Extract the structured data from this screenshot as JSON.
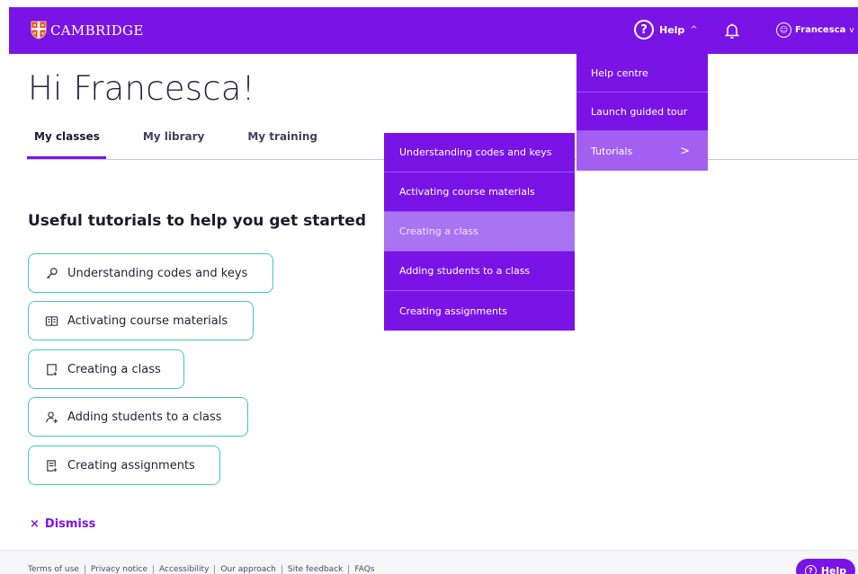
{
  "header": {
    "brand": "CAMBRIDGE",
    "help_label": "Help",
    "help_chevron": "^",
    "user_name": "Francesca",
    "user_chevron": "v"
  },
  "greeting": "Hi Francesca!",
  "tabs": [
    {
      "label": "My classes",
      "active": true
    },
    {
      "label": "My library",
      "active": false
    },
    {
      "label": "My training",
      "active": false
    }
  ],
  "tutorials": {
    "title": "Useful tutorials to help you get started",
    "items": [
      {
        "label": "Understanding codes and keys",
        "icon": "key-icon"
      },
      {
        "label": "Activating course materials",
        "icon": "book-icon"
      },
      {
        "label": "Creating a class",
        "icon": "add-document-icon"
      },
      {
        "label": "Adding students to a class",
        "icon": "add-user-icon"
      },
      {
        "label": "Creating assignments",
        "icon": "assignment-icon"
      }
    ],
    "dismiss": "Dismiss"
  },
  "help_menu": {
    "items": [
      "Help centre",
      "Launch guided tour",
      "Tutorials"
    ],
    "submenu_arrow": ">",
    "submenu": [
      "Understanding codes and keys",
      "Activating course materials",
      "Creating a class",
      "Adding students to a class",
      "Creating assignments"
    ],
    "hovered_index": 2
  },
  "footer": {
    "links": [
      "Terms of use",
      "Privacy notice",
      "Accessibility",
      "Our approach",
      "Site feedback",
      "FAQs"
    ],
    "help_button": "Help"
  },
  "colors": {
    "brand_purple": "#7a14e6",
    "teal_border": "#49c1c1",
    "hover_purple": "#a874f2"
  }
}
